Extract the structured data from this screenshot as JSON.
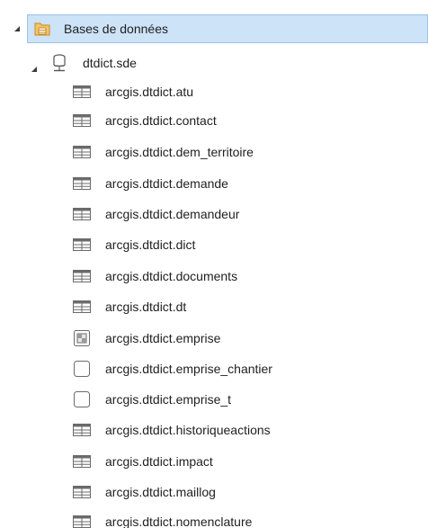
{
  "tree": {
    "root": {
      "label": "Bases de données",
      "icon": "database-folder-icon",
      "expanded": true,
      "selected": true
    },
    "connection": {
      "label": "dtdict.sde",
      "icon": "geodatabase-connection-icon",
      "expanded": true
    },
    "items": [
      {
        "label": "arcgis.dtdict.atu",
        "icon": "table-icon"
      },
      {
        "label": "arcgis.dtdict.contact",
        "icon": "table-icon"
      },
      {
        "label": "arcgis.dtdict.dem_territoire",
        "icon": "table-icon"
      },
      {
        "label": "arcgis.dtdict.demande",
        "icon": "table-icon"
      },
      {
        "label": "arcgis.dtdict.demandeur",
        "icon": "table-icon"
      },
      {
        "label": "arcgis.dtdict.dict",
        "icon": "table-icon"
      },
      {
        "label": "arcgis.dtdict.documents",
        "icon": "table-icon"
      },
      {
        "label": "arcgis.dtdict.dt",
        "icon": "table-icon"
      },
      {
        "label": "arcgis.dtdict.emprise",
        "icon": "raster-icon"
      },
      {
        "label": "arcgis.dtdict.emprise_chantier",
        "icon": "polygon-feature-class-icon"
      },
      {
        "label": "arcgis.dtdict.emprise_t",
        "icon": "polygon-feature-class-icon"
      },
      {
        "label": "arcgis.dtdict.historiqueactions",
        "icon": "table-icon"
      },
      {
        "label": "arcgis.dtdict.impact",
        "icon": "table-icon"
      },
      {
        "label": "arcgis.dtdict.maillog",
        "icon": "table-icon"
      },
      {
        "label": "arcgis.dtdict.nomenclature",
        "icon": "table-icon"
      }
    ]
  },
  "colors": {
    "selection_background": "#cde3f7",
    "selection_border": "#99c3ea",
    "folder_icon": "#e8a33a",
    "icon_gray": "#6b6b6b"
  }
}
